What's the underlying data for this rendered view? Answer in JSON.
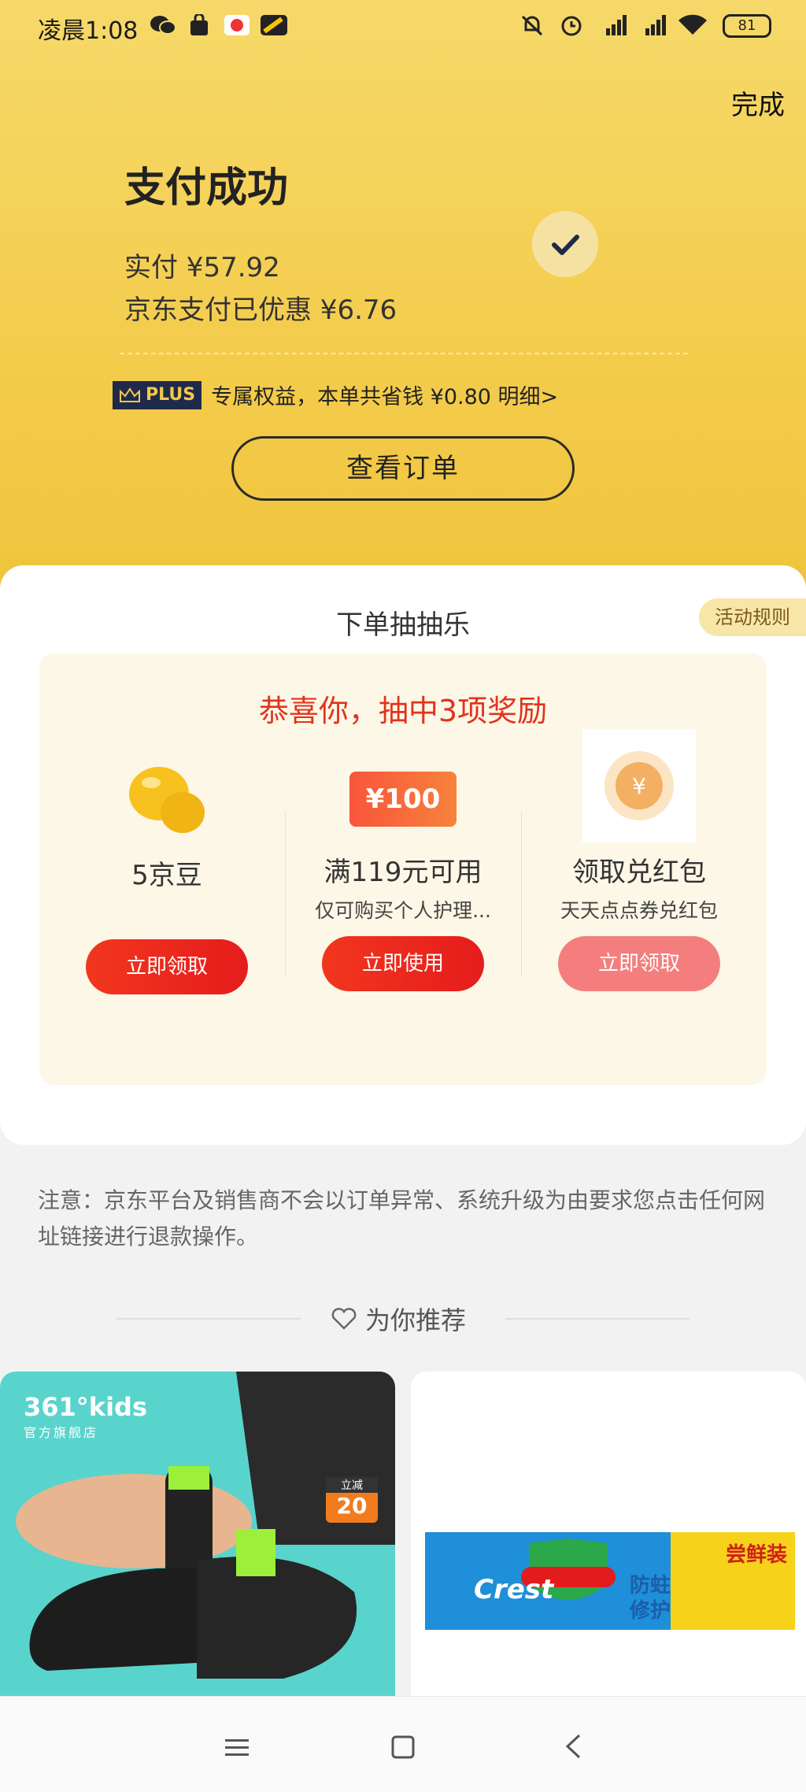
{
  "status_bar": {
    "time": "凌晨1:08",
    "battery": "81"
  },
  "header": {
    "done_label": "完成"
  },
  "payment": {
    "title": "支付成功",
    "paid": "实付 ¥57.92",
    "discount": "京东支付已优惠 ¥6.76",
    "plus_badge": "PLUS",
    "plus_text": "专属权益，本单共省钱 ¥0.80 明细>",
    "view_order_label": "查看订单"
  },
  "lottery": {
    "title": "下单抽抽乐",
    "rules_label": "活动规则",
    "congrats": "恭喜你，抽中3项奖励",
    "prizes": [
      {
        "name": "5京豆",
        "sub": "",
        "button": "立即领取"
      },
      {
        "coupon": "¥100",
        "name": "满119元可用",
        "sub": "仅可购买个人护理...",
        "button": "立即使用"
      },
      {
        "name": "领取兑红包",
        "sub": "天天点点券兑红包",
        "button": "立即领取"
      }
    ]
  },
  "notice": "注意：京东平台及销售商不会以订单异常、系统升级为由要求您点击任何网址链接进行退款操作。",
  "recommend": {
    "label": "为你推荐",
    "products": [
      {
        "brand": "361°kids",
        "brand_sub": "官方旗舰店",
        "badge_top": "立减",
        "badge_value": "20"
      },
      {
        "brand": "Crest 佳洁士",
        "tag": "防蛀修护",
        "tag2": "尝鲜装"
      }
    ]
  },
  "colors": {
    "accent_yellow": "#f4cd4e",
    "button_red": "#e51c1c",
    "congrats_red": "#e0341e"
  }
}
